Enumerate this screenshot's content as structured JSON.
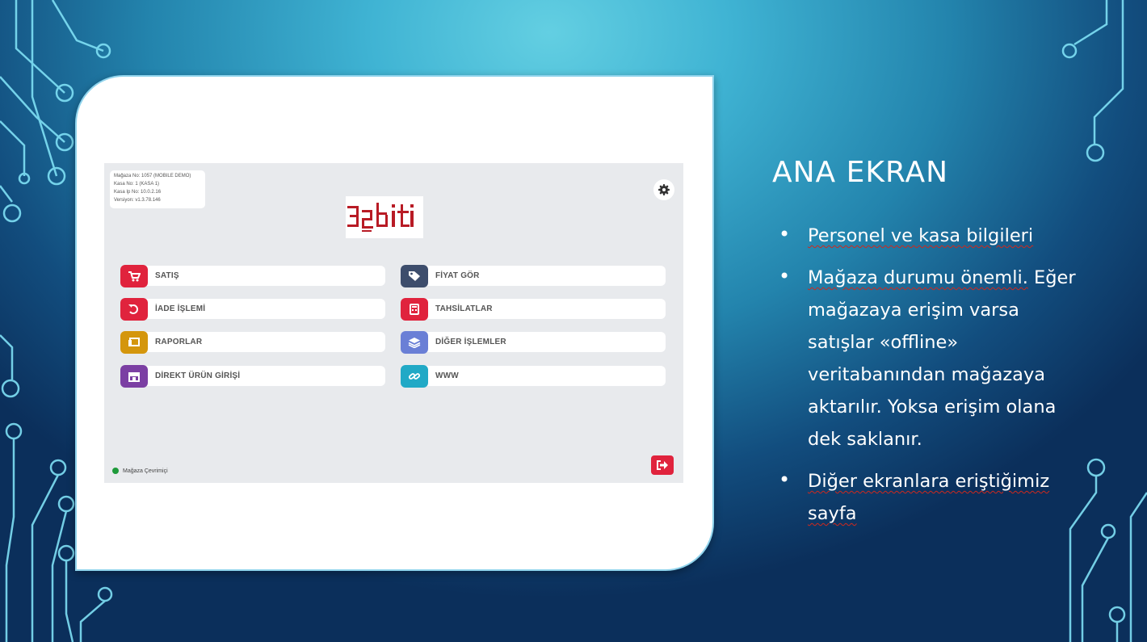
{
  "slide": {
    "title": "ANA EKRAN",
    "bullets": [
      {
        "text": "Personel ve kasa bilgileri",
        "underlined": true
      },
      {
        "text": "Mağaza durumu önemli.",
        "underlined": true,
        "continuation": "Eğer mağazaya erişim varsa satışlar «offline» veritabanından mağazaya aktarılır. Yoksa erişim olana dek saklanır."
      },
      {
        "text": "Diğer ekranlara eriştiğimiz sayfa",
        "underlined": true
      }
    ]
  },
  "app": {
    "info": {
      "store": "Mağaza No: 1057 (MOBILE DEMO)",
      "register": "Kasa No: 1 (KASA 1)",
      "ip": "Kasa Ip No: 10.0.2.16",
      "version": "Versiyon: v1.3.78.146"
    },
    "logo_text": "32bit",
    "menu": [
      {
        "label": "SATIŞ",
        "icon": "cart-icon",
        "color": "#e0233d"
      },
      {
        "label": "FİYAT GÖR",
        "icon": "tag-icon",
        "color": "#3d4d6c"
      },
      {
        "label": "İADE İŞLEMİ",
        "icon": "undo-icon",
        "color": "#e0233d"
      },
      {
        "label": "TAHSİLATLAR",
        "icon": "calculator-icon",
        "color": "#e0233d"
      },
      {
        "label": "RAPORLAR",
        "icon": "report-icon",
        "color": "#d4960d"
      },
      {
        "label": "DİĞER İŞLEMLER",
        "icon": "layers-icon",
        "color": "#6a7fd6"
      },
      {
        "label": "DİREKT ÜRÜN GİRİŞİ",
        "icon": "store-icon",
        "color": "#7b3fa3"
      },
      {
        "label": "WWW",
        "icon": "link-icon",
        "color": "#21a9c6"
      }
    ],
    "status_text": "Mağaza Çevrimiçi",
    "status_color": "#1e9a3a",
    "logout_icon": "logout-icon",
    "settings_icon": "gear-icon"
  }
}
